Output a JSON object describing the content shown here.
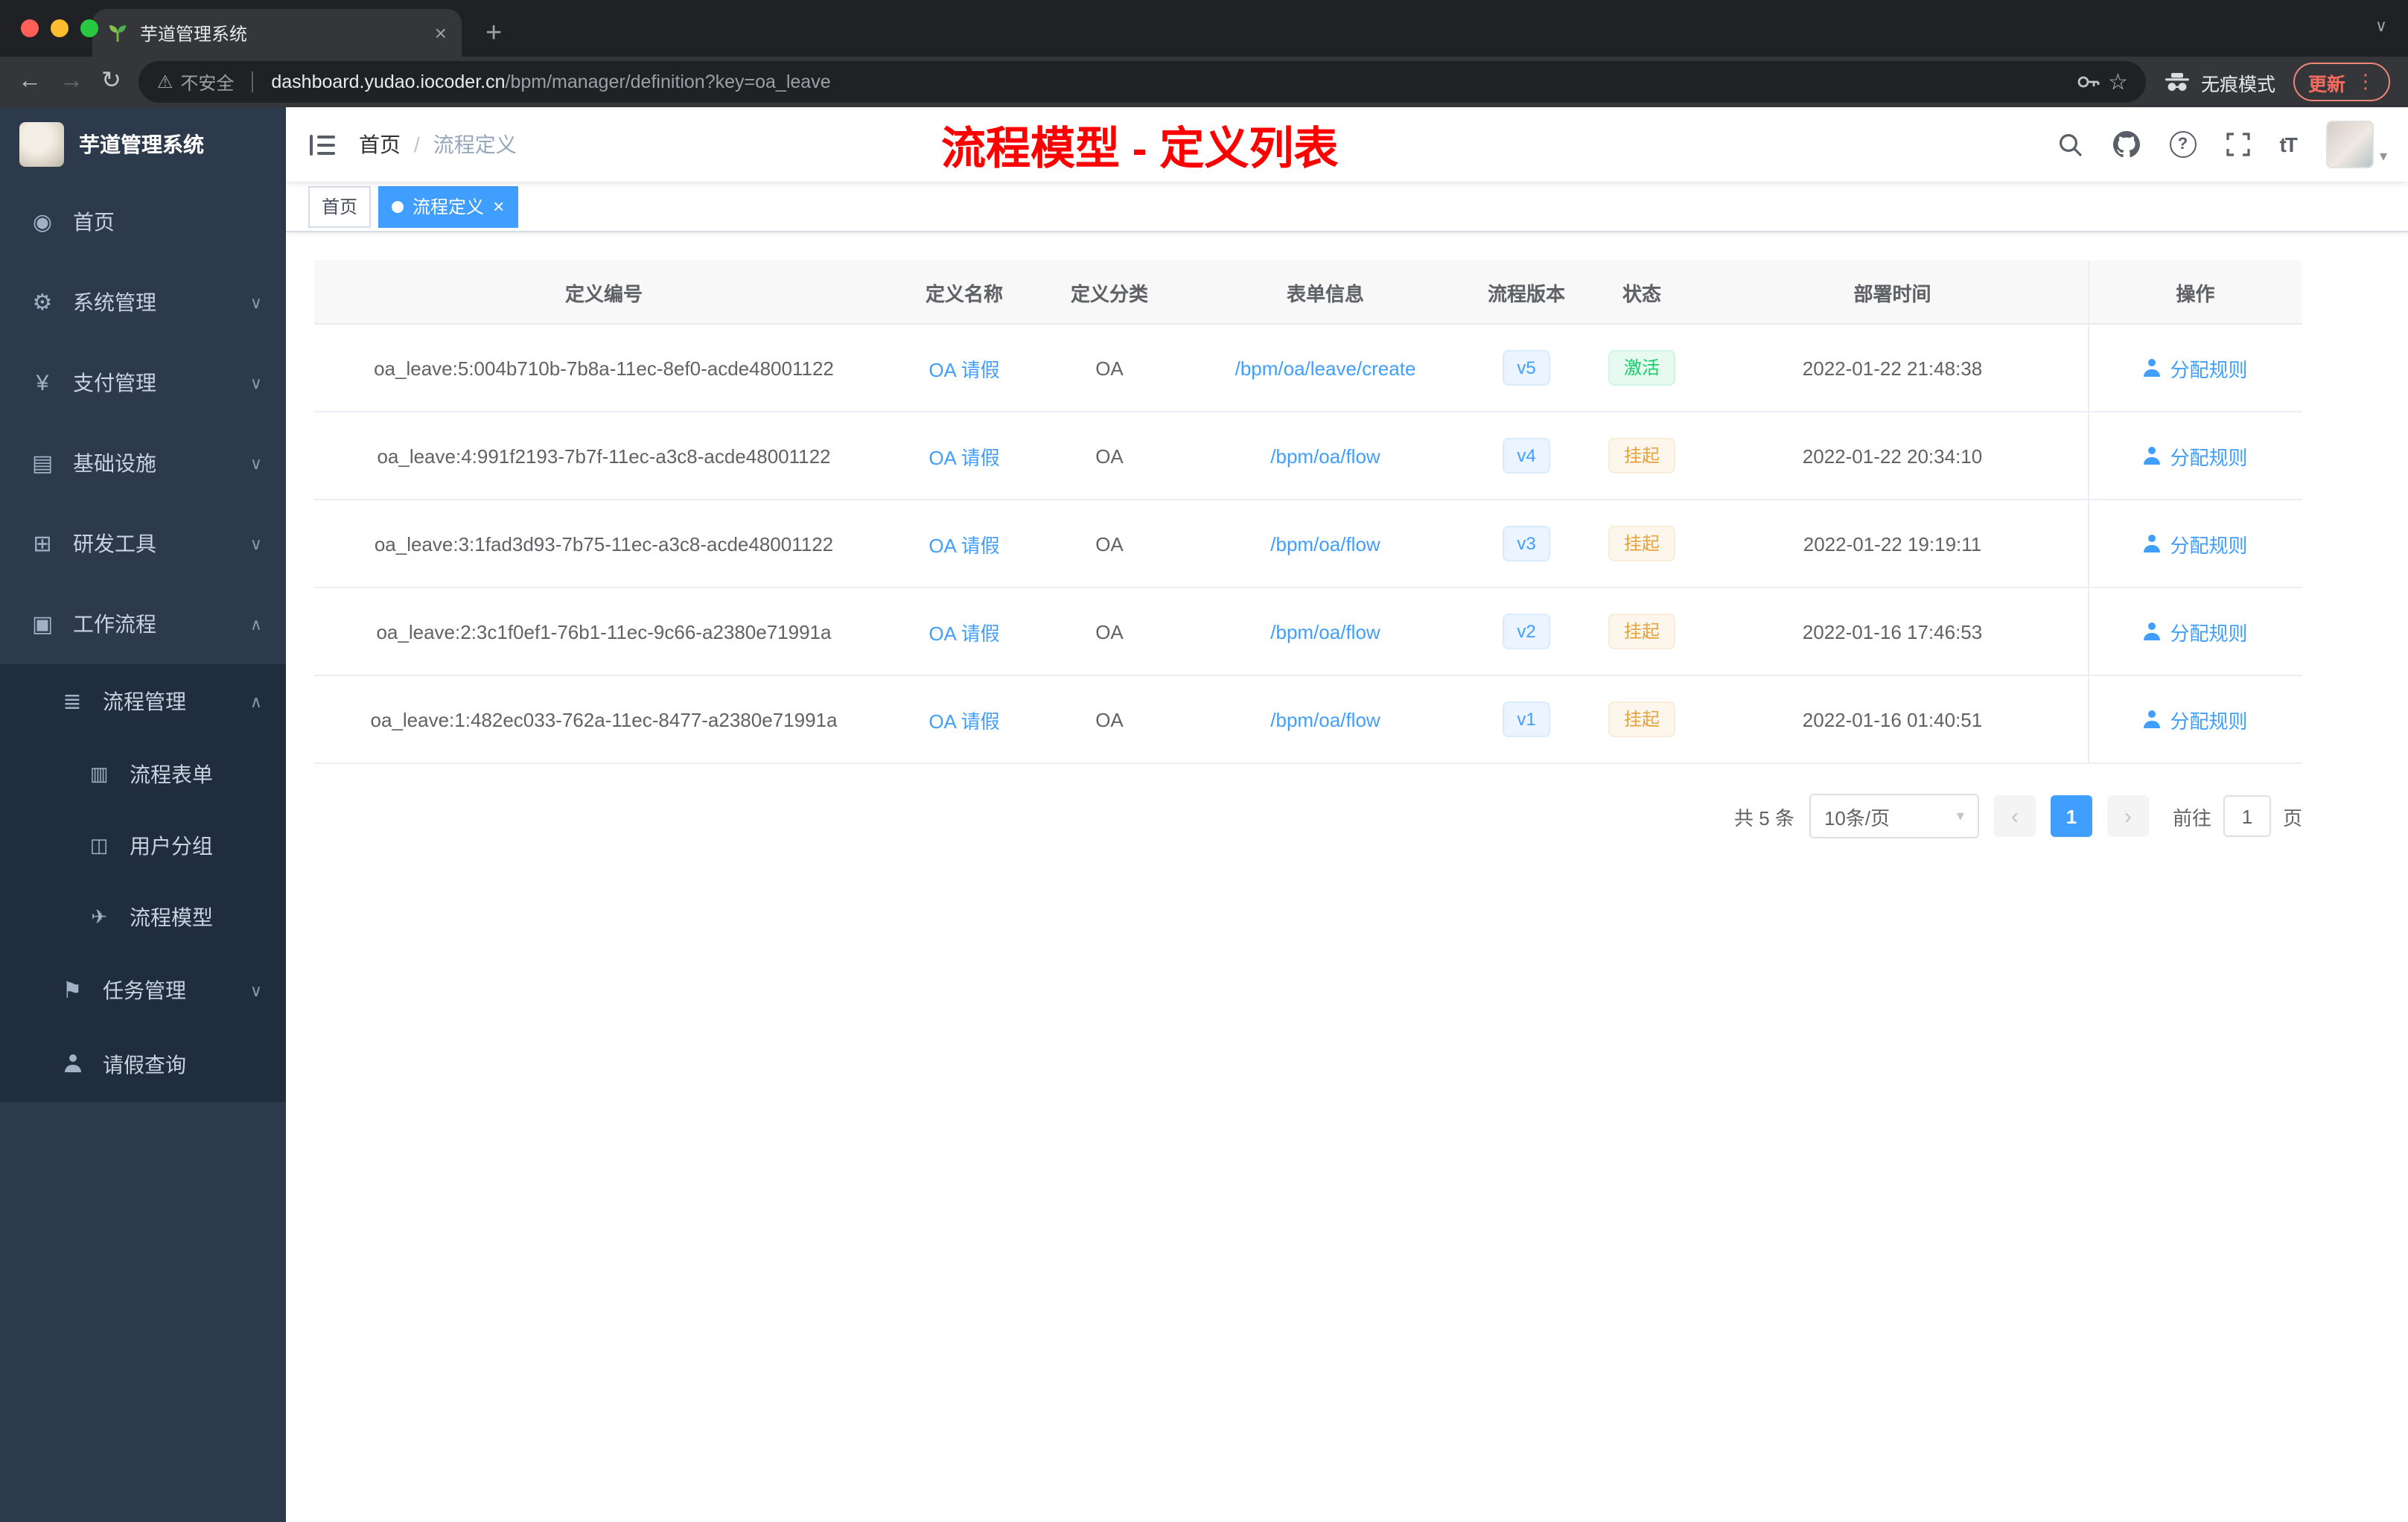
{
  "browser": {
    "tab_title": "芋道管理系统",
    "security": "不安全",
    "url_host": "dashboard.yudao.iocoder.cn",
    "url_path": "/bpm/manager/definition?key=oa_leave",
    "incognito": "无痕模式",
    "update": "更新"
  },
  "glyphs": {
    "back": "←",
    "forward": "→",
    "reload": "↻",
    "warning": "⚠",
    "star": "☆",
    "menu_dots": "⋮",
    "tab_close": "×",
    "new_tab": "+",
    "window_caret": "∨",
    "chevron_down": "∨",
    "chevron_up": "∧",
    "select_caret": "▾",
    "avatar_caret": "▾",
    "question": "?",
    "font_size": "tT",
    "prev": "‹",
    "next": "›",
    "tag_close": "×",
    "breadcrumb_sep": "/"
  },
  "menu_icons": {
    "home": "◉",
    "system": "⚙",
    "payment": "¥",
    "infra": "▤",
    "devtools": "⊞",
    "workflow": "▣",
    "process_mgmt": "≣",
    "process_form": "▥",
    "user_group": "◫",
    "process_model": "✈",
    "task_mgmt": "⚑"
  },
  "sidebar": {
    "logo_title": "芋道管理系统",
    "home": "首页",
    "system": "系统管理",
    "payment": "支付管理",
    "infra": "基础设施",
    "devtools": "研发工具",
    "workflow": "工作流程",
    "process_mgmt": "流程管理",
    "process_form": "流程表单",
    "user_group": "用户分组",
    "process_model": "流程模型",
    "task_mgmt": "任务管理",
    "leave_query": "请假查询"
  },
  "navbar": {
    "breadcrumb_home": "首页",
    "breadcrumb_current": "流程定义",
    "annotation": "流程模型 - 定义列表"
  },
  "tags": {
    "home": "首页",
    "current": "流程定义"
  },
  "table": {
    "headers": [
      "定义编号",
      "定义名称",
      "定义分类",
      "表单信息",
      "流程版本",
      "状态",
      "部署时间",
      "操作"
    ],
    "rows": [
      {
        "id": "oa_leave:5:004b710b-7b8a-11ec-8ef0-acde48001122",
        "name": "OA 请假",
        "category": "OA",
        "form": "/bpm/oa/leave/create",
        "version": "v5",
        "status": "激活",
        "status_type": "success",
        "time": "2022-01-22 21:48:38",
        "action": "分配规则"
      },
      {
        "id": "oa_leave:4:991f2193-7b7f-11ec-a3c8-acde48001122",
        "name": "OA 请假",
        "category": "OA",
        "form": "/bpm/oa/flow",
        "version": "v4",
        "status": "挂起",
        "status_type": "warning",
        "time": "2022-01-22 20:34:10",
        "action": "分配规则"
      },
      {
        "id": "oa_leave:3:1fad3d93-7b75-11ec-a3c8-acde48001122",
        "name": "OA 请假",
        "category": "OA",
        "form": "/bpm/oa/flow",
        "version": "v3",
        "status": "挂起",
        "status_type": "warning",
        "time": "2022-01-22 19:19:11",
        "action": "分配规则"
      },
      {
        "id": "oa_leave:2:3c1f0ef1-76b1-11ec-9c66-a2380e71991a",
        "name": "OA 请假",
        "category": "OA",
        "form": "/bpm/oa/flow",
        "version": "v2",
        "status": "挂起",
        "status_type": "warning",
        "time": "2022-01-16 17:46:53",
        "action": "分配规则"
      },
      {
        "id": "oa_leave:1:482ec033-762a-11ec-8477-a2380e71991a",
        "name": "OA 请假",
        "category": "OA",
        "form": "/bpm/oa/flow",
        "version": "v1",
        "status": "挂起",
        "status_type": "warning",
        "time": "2022-01-16 01:40:51",
        "action": "分配规则"
      }
    ]
  },
  "pagination": {
    "total": "共 5 条",
    "page_size": "10条/页",
    "page": "1",
    "goto": "前往",
    "goto_value": "1",
    "unit": "页"
  },
  "colors": {
    "accent": "#409eff",
    "success": "#13ce66",
    "warning": "#e6a23c",
    "annotation_red": "#ff0000",
    "sidebar_bg": "#2d3a4b",
    "submenu_bg": "#1f2d3d"
  }
}
